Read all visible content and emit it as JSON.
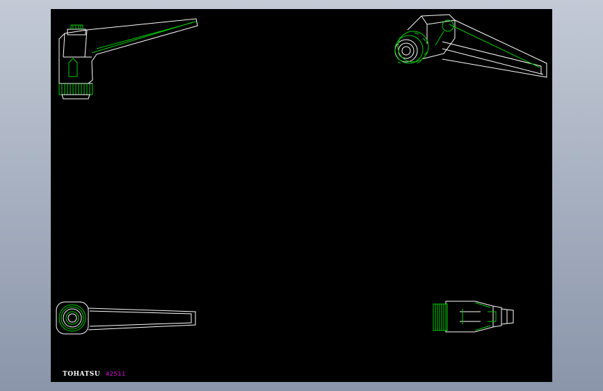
{
  "drawing": {
    "brand": "TOHATSU",
    "part_number": "42511",
    "colors": {
      "background": "#000000",
      "line_primary": "#ffffff",
      "line_secondary": "#00cc00",
      "part_number_text": "#ff00ff"
    },
    "views": [
      {
        "name": "side-view"
      },
      {
        "name": "isometric-view"
      },
      {
        "name": "top-view"
      },
      {
        "name": "end-view"
      }
    ]
  }
}
